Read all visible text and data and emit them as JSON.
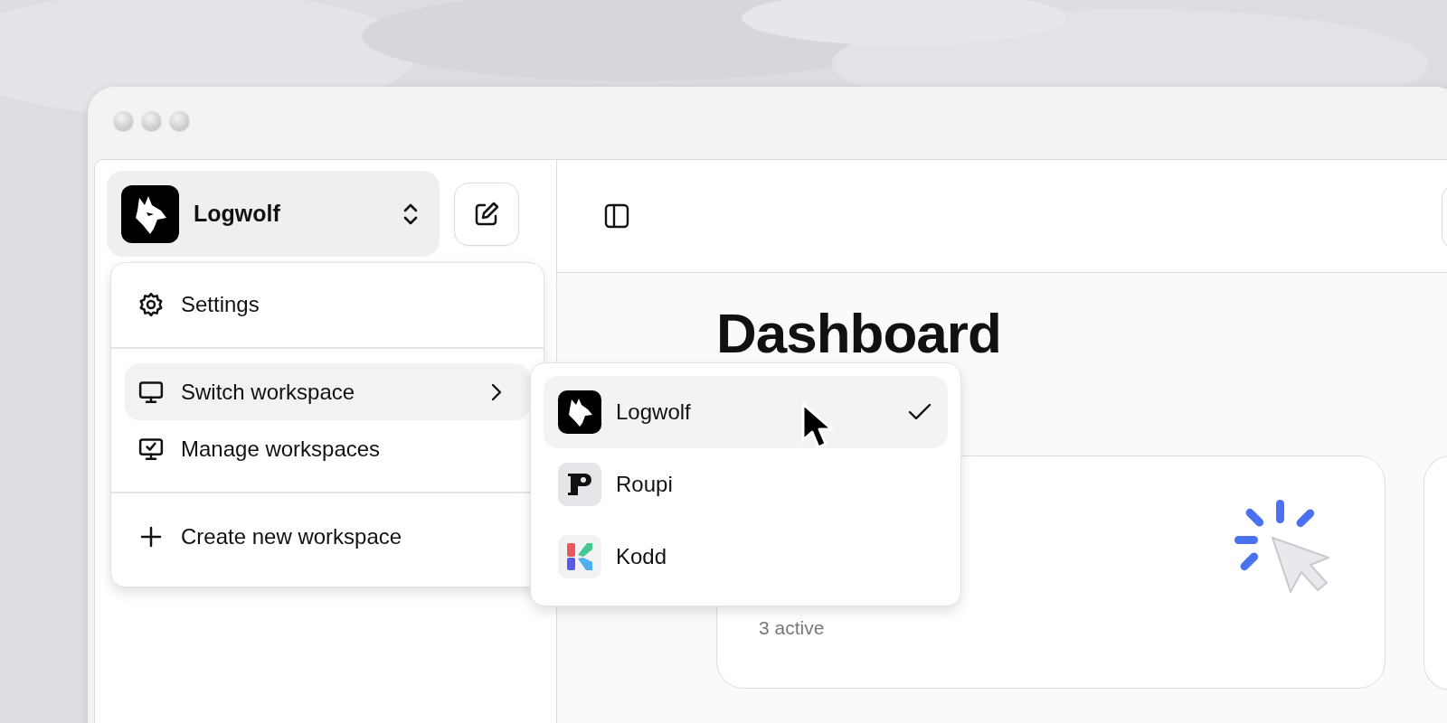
{
  "workspace_switcher": {
    "name": "Logwolf"
  },
  "menu": {
    "groups": [
      {
        "items": [
          {
            "label": "Settings",
            "kind": "item",
            "expanded": false
          }
        ]
      },
      {
        "items": [
          {
            "label": "Switch workspace",
            "kind": "submenu",
            "expanded": true
          },
          {
            "label": "Manage workspaces",
            "kind": "item",
            "expanded": false
          }
        ]
      },
      {
        "items": [
          {
            "label": "Create new workspace",
            "kind": "item",
            "expanded": false
          }
        ]
      }
    ]
  },
  "submenu": {
    "workspaces": [
      {
        "name": "Logwolf",
        "selected": true
      },
      {
        "name": "Roupi",
        "selected": false
      },
      {
        "name": "Kodd",
        "selected": false
      }
    ]
  },
  "main": {
    "title": "Dashboard",
    "card": {
      "caption": "3 active"
    }
  }
}
